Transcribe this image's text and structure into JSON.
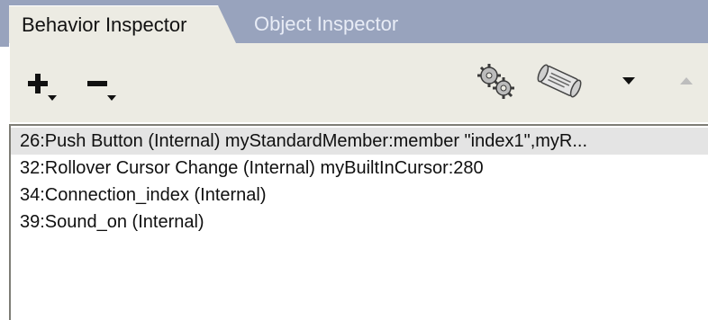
{
  "tabs": {
    "behavior": "Behavior Inspector",
    "object": "Object Inspector"
  },
  "toolbar": {
    "add_icon": "plus-dropdown-icon",
    "remove_icon": "minus-dropdown-icon",
    "gear_icon": "gears-icon",
    "script_icon": "script-scroll-icon",
    "down_icon": "arrow-down-icon",
    "up_icon": "arrow-up-icon"
  },
  "behaviors": [
    "26:Push Button (Internal) myStandardMember:member \"index1\",myR...",
    "32:Rollover Cursor Change (Internal) myBuiltInCursor:280",
    "34:Connection_index (Internal)",
    "39:Sound_on (Internal)"
  ],
  "colors": {
    "tabstrip": "#98a3bd",
    "panel": "#ecebe3",
    "selected_row": "#e4e4e4"
  }
}
